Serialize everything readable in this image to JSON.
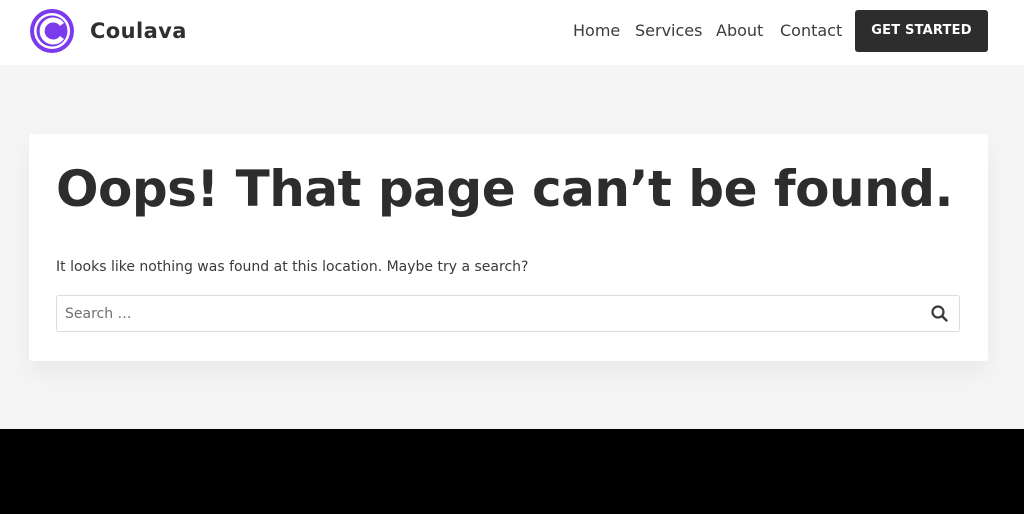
{
  "header": {
    "brand": "Coulava",
    "nav": [
      {
        "label": "Home"
      },
      {
        "label": "Services"
      },
      {
        "label": "About"
      },
      {
        "label": "Contact"
      }
    ],
    "cta_label": "GET STARTED"
  },
  "main": {
    "title": "Oops! That page can’t be found.",
    "message": "It looks like nothing was found at this location. Maybe try a search?",
    "search": {
      "placeholder": "Search …",
      "value": ""
    }
  },
  "icons": {
    "logo": "logo-icon",
    "search": "search-icon"
  },
  "colors": {
    "accent": "#7c3aed",
    "dark": "#2d2d2d",
    "background": "#f5f5f5",
    "footer": "#000000"
  }
}
